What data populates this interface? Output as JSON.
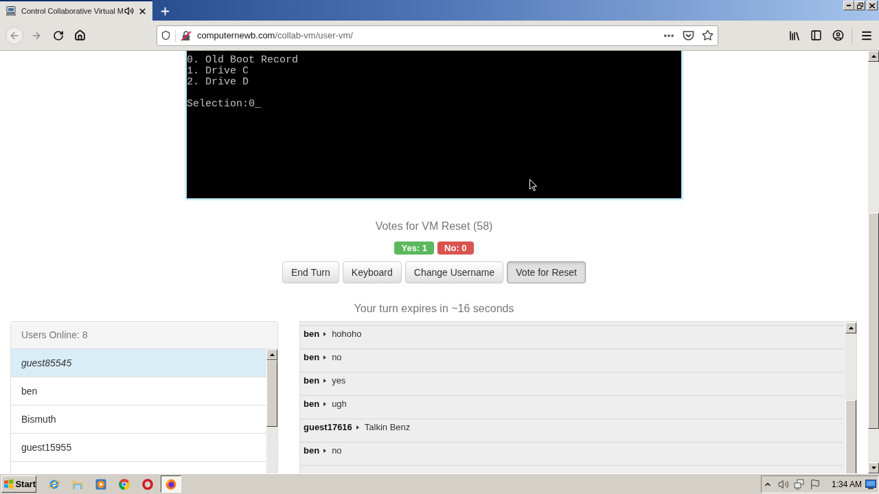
{
  "browser": {
    "tab": {
      "title": "Control Collaborative Virtual M"
    },
    "address_bar": {
      "domain": "computernewb.com",
      "path": "/collab-vm/user-vm/"
    }
  },
  "vm_screen": {
    "menu": [
      "0. Old Boot Record",
      "1. Drive C",
      "2. Drive D"
    ],
    "prompt": "Selection:0_"
  },
  "vote": {
    "title": "Votes for VM Reset (58)",
    "tallies": [
      {
        "label": "Yes: 1",
        "color": "#5cb85c"
      },
      {
        "label": "No: 0",
        "color": "#d9534f"
      }
    ]
  },
  "buttons": [
    {
      "label": "End Turn",
      "pressed": false
    },
    {
      "label": "Keyboard",
      "pressed": false
    },
    {
      "label": "Change Username",
      "pressed": false
    },
    {
      "label": "Vote for Reset",
      "pressed": true
    }
  ],
  "turn_status": "Your turn expires in ~16 seconds",
  "users": {
    "header": "Users Online: 8",
    "items": [
      {
        "name": "guest85545",
        "selected": true
      },
      {
        "name": "ben",
        "selected": false
      },
      {
        "name": "Bismuth",
        "selected": false
      },
      {
        "name": "guest15955",
        "selected": false
      }
    ]
  },
  "chat": {
    "messages": [
      {
        "user": "ben",
        "text": "hohoho"
      },
      {
        "user": "ben",
        "text": "no"
      },
      {
        "user": "ben",
        "text": "yes"
      },
      {
        "user": "ben",
        "text": "ugh"
      },
      {
        "user": "guest17616",
        "text": "Talkin Benz"
      },
      {
        "user": "ben",
        "text": "no"
      }
    ]
  },
  "taskbar": {
    "start": "Start",
    "apps": [
      {
        "kind": "ie",
        "selected": false
      },
      {
        "kind": "explorer",
        "selected": false
      },
      {
        "kind": "media",
        "selected": false
      },
      {
        "kind": "chrome",
        "selected": false
      },
      {
        "kind": "opera",
        "selected": false
      },
      {
        "kind": "firefox",
        "selected": true
      }
    ],
    "clock": "1:34 AM"
  }
}
